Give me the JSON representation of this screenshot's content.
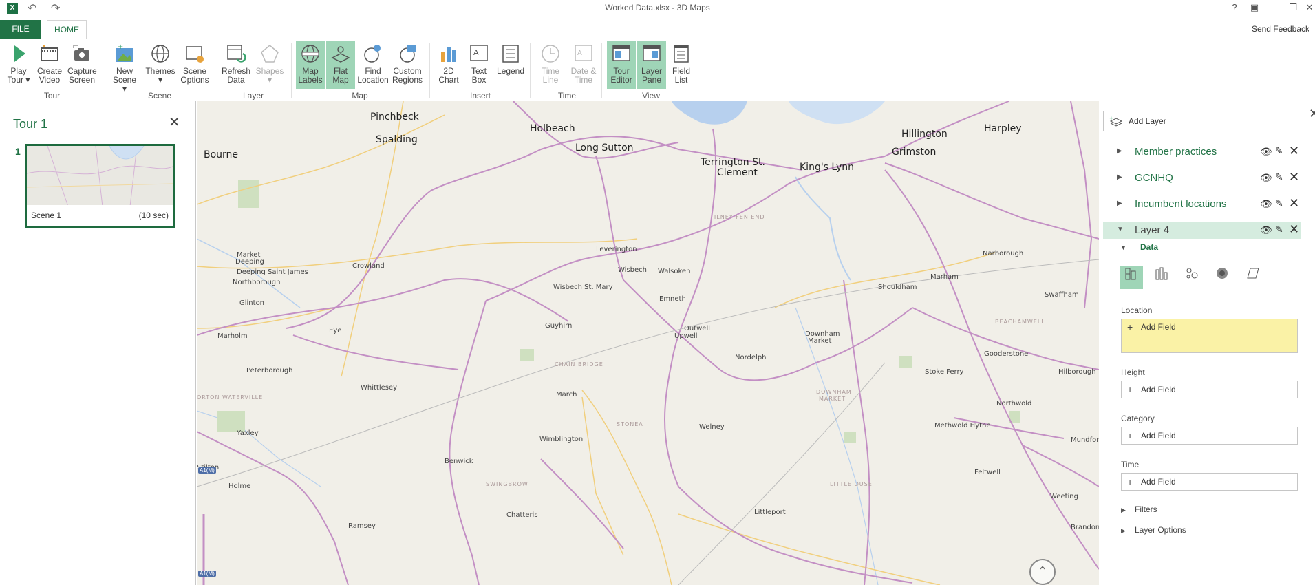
{
  "window": {
    "title": "Worked Data.xlsx - 3D Maps",
    "help": "?",
    "controls": [
      "restore-ribbon",
      "minimize",
      "maximize",
      "close"
    ]
  },
  "tabs": {
    "file": "FILE",
    "home": "HOME",
    "send_feedback": "Send Feedback"
  },
  "ribbon": {
    "groups": [
      {
        "label": "Tour"
      },
      {
        "label": "Scene"
      },
      {
        "label": "Layer"
      },
      {
        "label": "Map"
      },
      {
        "label": "Insert"
      },
      {
        "label": "Time"
      },
      {
        "label": "View"
      }
    ],
    "buttons": {
      "play_tour": [
        "Play",
        "Tour ▾"
      ],
      "create_video": [
        "Create",
        "Video"
      ],
      "capture_screen": [
        "Capture",
        "Screen"
      ],
      "new_scene": [
        "New",
        "Scene ▾"
      ],
      "themes": [
        "Themes",
        "▾"
      ],
      "scene_options": [
        "Scene",
        "Options"
      ],
      "refresh_data": [
        "Refresh",
        "Data"
      ],
      "shapes": [
        "Shapes",
        "▾"
      ],
      "map_labels": [
        "Map",
        "Labels"
      ],
      "flat_map": [
        "Flat",
        "Map"
      ],
      "find_location": [
        "Find",
        "Location"
      ],
      "custom_regions": [
        "Custom",
        "Regions"
      ],
      "chart_2d": [
        "2D",
        "Chart"
      ],
      "text_box": [
        "Text",
        "Box"
      ],
      "legend": [
        "Legend",
        ""
      ],
      "time_line": [
        "Time",
        "Line"
      ],
      "date_time": [
        "Date &",
        "Time"
      ],
      "tour_editor": [
        "Tour",
        "Editor"
      ],
      "layer_pane": [
        "Layer",
        "Pane"
      ],
      "field_list": [
        "Field",
        "List"
      ]
    }
  },
  "tour": {
    "title": "Tour 1",
    "scene_number": "1",
    "scene_name": "Scene 1",
    "scene_duration": "(10 sec)"
  },
  "map": {
    "towns_big": [
      "Pinchbeck",
      "Holbeach",
      "Spalding",
      "Long Sutton",
      "Bourne",
      "Terrington St.",
      "Clement",
      "King's Lynn",
      "Hillington",
      "Harpley",
      "Grimston"
    ],
    "towns_mid": [
      "Market",
      "Deeping",
      "Deeping Saint James",
      "Northborough",
      "Crowland",
      "Leverington",
      "Wisbech",
      "Walsoken",
      "Wisbech St. Mary",
      "Emneth",
      "Glinton",
      "Guyhirn",
      "Outwell",
      "Upwell",
      "Marholm",
      "Eye",
      "Peterborough",
      "Whittlesey",
      "Nordelph",
      "Downham",
      "Market",
      "Narborough",
      "Marham",
      "Shouldham",
      "Swaffham",
      "Gooderstone",
      "Stoke Ferry",
      "Hilborough",
      "Northwold",
      "Methwold Hythe",
      "Mundford",
      "Feltwell",
      "Weeting",
      "March",
      "Welney",
      "Wimblington",
      "Benwick",
      "Yaxley",
      "Stilton",
      "Holme",
      "Chatteris",
      "Littleport",
      "Ramsey",
      "Brandon"
    ],
    "areas": [
      "TILNEY FEN END",
      "BEACHAMWELL",
      "CHAIN BRIDGE",
      "DOWNHAM",
      "MARKET",
      "STONEA",
      "SWINGBROW",
      "LITTLE OUSE",
      "ORTON WATERVILLE"
    ],
    "road_shields": [
      "A1(M)",
      "A1(M)"
    ]
  },
  "layers": {
    "add_layer": "Add Layer",
    "items": [
      {
        "name": "Member practices"
      },
      {
        "name": "GCNHQ"
      },
      {
        "name": "Incumbent locations"
      },
      {
        "name": "Layer 4"
      }
    ],
    "data_label": "Data",
    "location_label": "Location",
    "height_label": "Height",
    "category_label": "Category",
    "time_label": "Time",
    "add_field": "Add Field",
    "filters": "Filters",
    "layer_options": "Layer Options"
  },
  "colors": {
    "accent": "#217346",
    "active_button": "#9fd5b7",
    "selected_row": "#d5ecdf",
    "location_box": "#faf2a6",
    "water": "#b7d0ee",
    "road_major": "#c38fc4",
    "road_minor": "#f1cf7d"
  }
}
